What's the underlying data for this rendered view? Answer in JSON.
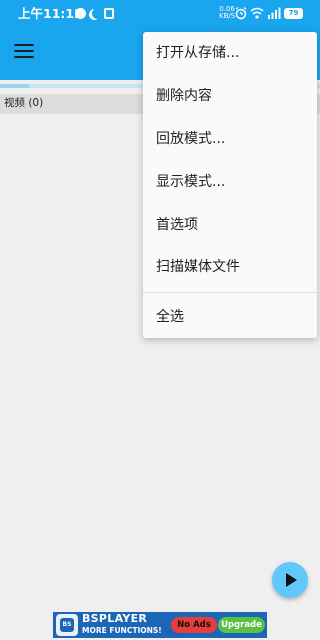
{
  "status_bar": {
    "time": "上午11:12",
    "network_speed_value": "0.06",
    "network_speed_unit": "KB/S",
    "battery": "79"
  },
  "app_bar": {
    "menu_icon": "hamburger-icon"
  },
  "content": {
    "section_label": "视频 (0)"
  },
  "overflow_menu": {
    "items": [
      {
        "label": "打开从存储..."
      },
      {
        "label": "删除内容"
      },
      {
        "label": "回放模式..."
      },
      {
        "label": "显示模式..."
      },
      {
        "label": "首选项"
      },
      {
        "label": "扫描媒体文件"
      },
      {
        "label": "全选"
      }
    ]
  },
  "fab": {
    "icon": "play-icon"
  },
  "ad": {
    "logo_text": "BS",
    "brand": "BSPLAYER",
    "tagline": "MORE FUNCTIONS!",
    "no_ads": "No Ads",
    "upgrade": "Upgrade"
  },
  "colors": {
    "primary": "#1aa5ef",
    "fab": "#62c7fb",
    "background": "#efefef",
    "menu_background": "#fafafa"
  }
}
